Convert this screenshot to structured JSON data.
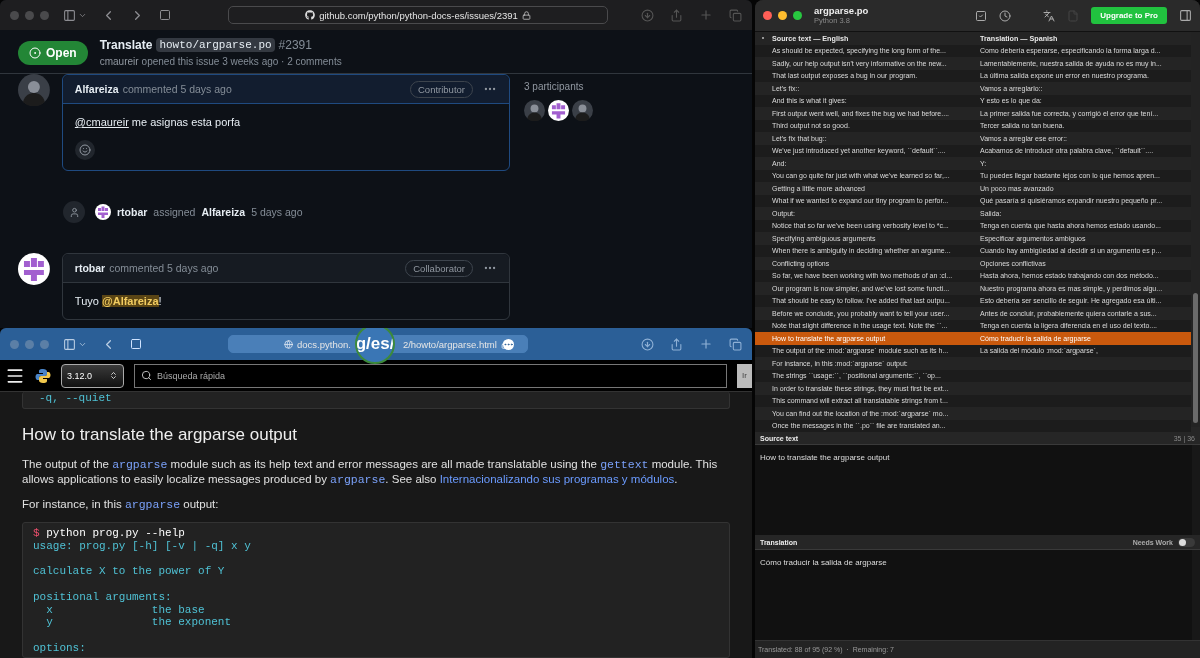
{
  "github_window": {
    "url": "github.com/python/python-docs-es/issues/2391",
    "can_go_forward": true,
    "issue": {
      "state": "Open",
      "title": "Translate",
      "file": "howto/argparse.po",
      "number": "#2391",
      "author": "cmaureir",
      "meta": "opened this issue 3 weeks ago · 2 comments"
    },
    "timeline": [
      {
        "kind": "comment",
        "avatar": {
          "kind": "photo"
        },
        "author": "Alfareiza",
        "action": "commented 5 days ago",
        "role": "Contributor",
        "highlighted": true,
        "reactions": true,
        "body": [
          {
            "kind": "mention",
            "text": "@cmaureir"
          },
          {
            "kind": "text",
            "text": " me asignas esta porfa"
          }
        ]
      },
      {
        "kind": "event",
        "avatar": {
          "kind": "identicon"
        },
        "actor": "rtobar",
        "action": "assigned",
        "target": "Alfareiza",
        "time": "5 days ago"
      },
      {
        "kind": "comment",
        "avatar": {
          "kind": "identicon"
        },
        "author": "rtobar",
        "action": "commented 5 days ago",
        "role": "Collaborator",
        "highlighted": false,
        "reactions": false,
        "body": [
          {
            "kind": "text",
            "text": "Tuyo "
          },
          {
            "kind": "mention-highlight",
            "text": "@Alfareiza"
          },
          {
            "kind": "text",
            "text": "!"
          }
        ]
      }
    ],
    "participants": {
      "label": "3 participants",
      "avatars": [
        {
          "kind": "photo"
        },
        {
          "kind": "identicon"
        },
        {
          "kind": "photo"
        }
      ]
    }
  },
  "docs_window": {
    "url_start": "docs.python.",
    "url_lens": "g/es/",
    "url_end": "2/howto/argparse.html",
    "can_go_forward": false,
    "version": "3.12.0",
    "search": {
      "placeholder": "Búsqueda rápida"
    },
    "go_button": "Ir",
    "top_code": [
      "-q, --quiet"
    ],
    "heading": "How to translate the argparse output",
    "paragraphs": [
      [
        {
          "kind": "text",
          "text": "The output of the "
        },
        {
          "kind": "code",
          "text": "argparse"
        },
        {
          "kind": "text",
          "text": " module such as its help text and error messages are all made translatable using the "
        },
        {
          "kind": "code",
          "text": "gettext"
        },
        {
          "kind": "text",
          "text": " module. This allows applications to easily localize messages produced by "
        },
        {
          "kind": "code",
          "text": "argparse"
        },
        {
          "kind": "text",
          "text": ". See also "
        },
        {
          "kind": "link",
          "text": "Internacionalizando sus programas y módulos"
        },
        {
          "kind": "text",
          "text": "."
        }
      ],
      [
        {
          "kind": "text",
          "text": "For instance, in this "
        },
        {
          "kind": "code",
          "text": "argparse"
        },
        {
          "kind": "text",
          "text": " output:"
        }
      ]
    ],
    "code_block": [
      {
        "kind": "command",
        "prompt": "$",
        "text": "python prog.py --help"
      },
      {
        "kind": "output",
        "text": "usage: prog.py [-h] [-v | -q] x y"
      },
      {
        "kind": "blank"
      },
      {
        "kind": "output",
        "text": "calculate X to the power of Y"
      },
      {
        "kind": "blank"
      },
      {
        "kind": "output",
        "text": "positional arguments:"
      },
      {
        "kind": "output",
        "text": "  x               the base"
      },
      {
        "kind": "output",
        "text": "  y               the exponent"
      },
      {
        "kind": "blank"
      },
      {
        "kind": "output",
        "text": "options:"
      }
    ]
  },
  "editor": {
    "title": "argparse.po",
    "subtitle": "Python 3.8",
    "upgrade_button": "Upgrade to Pro",
    "columns": [
      "Source text — English",
      "Translation — Spanish"
    ],
    "rows": [
      {
        "source": "As should be expected, specifying the long form of the...",
        "translation": "Como debería esperarse, especificando la forma larga d...",
        "selected": false
      },
      {
        "source": "Sadly, our help output isn't very informative on the new...",
        "translation": "Lamentablemente, nuestra salida de ayuda no es muy in...",
        "selected": false
      },
      {
        "source": "That last output exposes a bug in our program.",
        "translation": "La última salida expone un error en nuestro programa.",
        "selected": false
      },
      {
        "source": "Let's fix::",
        "translation": "Vamos a arreglarlo::",
        "selected": false
      },
      {
        "source": "And this is what it gives:",
        "translation": "Y esto es lo que da:",
        "selected": false
      },
      {
        "source": "First output went well, and fixes the bug we had before....",
        "translation": "La primer salida fue correcta, y corrigió el error que tení...",
        "selected": false
      },
      {
        "source": "Third output not so good.",
        "translation": "Tercer salida no tan buena.",
        "selected": false
      },
      {
        "source": "Let's fix that bug::",
        "translation": "Vamos a arreglar ese error::",
        "selected": false
      },
      {
        "source": "We've just introduced yet another keyword, ``default``....",
        "translation": "Acabamos de introducir otra palabra clave, ``default``....",
        "selected": false
      },
      {
        "source": "And:",
        "translation": "Y:",
        "selected": false
      },
      {
        "source": "You can go quite far just with what we've learned so far,...",
        "translation": "Tu puedes llegar bastante lejos con lo que hemos apren...",
        "selected": false
      },
      {
        "source": "Getting a little more advanced",
        "translation": "Un poco mas avanzado",
        "selected": false
      },
      {
        "source": "What if we wanted to expand our tiny program to perfor...",
        "translation": "Qué pasaría si quisiéramos expandir nuestro pequeño pr...",
        "selected": false
      },
      {
        "source": "Output:",
        "translation": "Salida:",
        "selected": false
      },
      {
        "source": "Notice that so far we've been using verbosity level to *c...",
        "translation": "Tenga en cuenta que hasta ahora hemos estado usando...",
        "selected": false
      },
      {
        "source": "Specifying ambiguous arguments",
        "translation": "Especificar argumentos ambiguos",
        "selected": false
      },
      {
        "source": "When there is ambiguity in deciding whether an argume...",
        "translation": "Cuando hay ambigüedad al decidir si un argumento es p...",
        "selected": false
      },
      {
        "source": "Conflicting options",
        "translation": "Opciones conflictivas",
        "selected": false
      },
      {
        "source": "So far, we have been working with two methods of an :cl...",
        "translation": "Hasta ahora, hemos estado trabajando con dos método...",
        "selected": false
      },
      {
        "source": "Our program is now simpler, and we've lost some functi...",
        "translation": "Nuestro programa ahora es mas simple, y perdimos algu...",
        "selected": false
      },
      {
        "source": "That should be easy to follow. I've added that last outpu...",
        "translation": "Esto debería ser sencillo de seguir. He agregado esa últi...",
        "selected": false
      },
      {
        "source": "Before we conclude, you probably want to tell your user...",
        "translation": "Antes de concluir, probablemente quiera contarle a sus...",
        "selected": false
      },
      {
        "source": "Note that slight difference in the usage text. Note the ``...",
        "translation": "Tenga en cuenta la ligera diferencia en el uso del texto....",
        "selected": false
      },
      {
        "source": "How to translate the argparse output",
        "translation": "Cómo traducir la salida de argparse",
        "selected": true
      },
      {
        "source": "The output of the :mod:`argparse` module such as its h...",
        "translation": "La salida del módulo :mod:`argparse`,",
        "selected": false
      },
      {
        "source": "For instance, in this :mod:`argparse` output:",
        "selected": false
      },
      {
        "source": "The strings ``usage:``, ``positional arguments:``, ``op...",
        "selected": false
      },
      {
        "source": "In order to translate these strings, they must first be ext...",
        "selected": false
      },
      {
        "source": "This command will extract all translatable strings from t...",
        "selected": false
      },
      {
        "source": "You can find out the location of the :mod:`argparse` mo...",
        "selected": false
      },
      {
        "source": "Once the messages in the ``.po`` file are translated an...",
        "selected": false
      }
    ],
    "source_panel": {
      "label": "Source text",
      "counter": "35 | 36",
      "text": "How to translate the argparse output"
    },
    "translation_panel": {
      "label": "Translation",
      "needs_work": {
        "label": "Needs Work",
        "on": false
      },
      "text": "Cómo traducir la salida de argparse"
    },
    "status_bar": "Translated: 88 of 95 (92 %)  ·  Remaining: 7"
  }
}
